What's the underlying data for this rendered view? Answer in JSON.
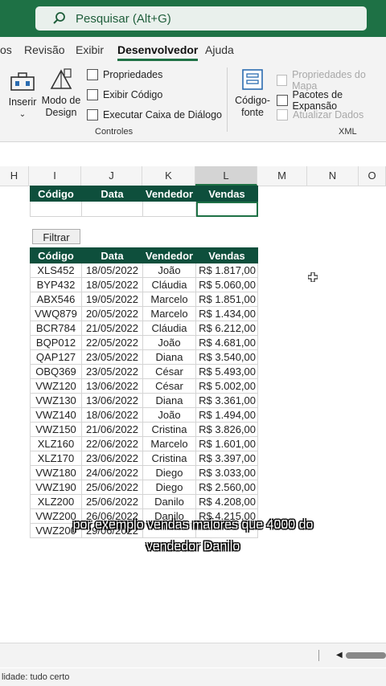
{
  "search": {
    "placeholder": "Pesquisar (Alt+G)"
  },
  "tabs": [
    "os",
    "Revisão",
    "Exibir",
    "Desenvolvedor",
    "Ajuda"
  ],
  "active_tab": "Desenvolvedor",
  "ribbon": {
    "inserir": "Inserir",
    "modo_design_1": "Modo de",
    "modo_design_2": "Design",
    "propriedades": "Propriedades",
    "exibir_codigo": "Exibir Código",
    "executar_caixa": "Executar Caixa de Diálogo",
    "controles_label": "Controles",
    "codigo_fonte_1": "Código-",
    "codigo_fonte_2": "fonte",
    "propriedades_mapa": "Propriedades do Mapa",
    "pacotes_expansao": "Pacotes de Expansão",
    "atualizar_dados": "Atualizar Dados",
    "xml_label": "XML"
  },
  "columns": [
    "H",
    "I",
    "J",
    "K",
    "L",
    "M",
    "N",
    "O"
  ],
  "selected_column": "L",
  "criteria_table": {
    "headers": [
      "Código",
      "Data",
      "Vendedor",
      "Vendas"
    ]
  },
  "filter_button": "Filtrar",
  "data_table": {
    "headers": [
      "Código",
      "Data",
      "Vendedor",
      "Vendas"
    ],
    "rows": [
      [
        "XLS452",
        "18/05/2022",
        "João",
        "R$ 1.817,00"
      ],
      [
        "BYP432",
        "18/05/2022",
        "Cláudia",
        "R$ 5.060,00"
      ],
      [
        "ABX546",
        "19/05/2022",
        "Marcelo",
        "R$ 1.851,00"
      ],
      [
        "VWQ879",
        "20/05/2022",
        "Marcelo",
        "R$ 1.434,00"
      ],
      [
        "BCR784",
        "21/05/2022",
        "Cláudia",
        "R$ 6.212,00"
      ],
      [
        "BQP012",
        "22/05/2022",
        "João",
        "R$ 4.681,00"
      ],
      [
        "QAP127",
        "23/05/2022",
        "Diana",
        "R$ 3.540,00"
      ],
      [
        "OBQ369",
        "23/05/2022",
        "César",
        "R$ 5.493,00"
      ],
      [
        "VWZ120",
        "13/06/2022",
        "César",
        "R$ 5.002,00"
      ],
      [
        "VWZ130",
        "13/06/2022",
        "Diana",
        "R$ 3.361,00"
      ],
      [
        "VWZ140",
        "18/06/2022",
        "João",
        "R$ 1.494,00"
      ],
      [
        "VWZ150",
        "21/06/2022",
        "Cristina",
        "R$ 3.826,00"
      ],
      [
        "XLZ160",
        "22/06/2022",
        "Marcelo",
        "R$ 1.601,00"
      ],
      [
        "XLZ170",
        "23/06/2022",
        "Cristina",
        "R$ 3.397,00"
      ],
      [
        "VWZ180",
        "24/06/2022",
        "Diego",
        "R$ 3.033,00"
      ],
      [
        "VWZ190",
        "25/06/2022",
        "Diego",
        "R$ 2.560,00"
      ],
      [
        "XLZ200",
        "25/06/2022",
        "Danilo",
        "R$ 4.208,00"
      ],
      [
        "VWZ200",
        "26/06/2022",
        "Danilo",
        "R$ 4.215,00"
      ],
      [
        "VWZ200",
        "29/06/2022",
        "",
        ""
      ]
    ]
  },
  "caption": {
    "line1": "por exemplo vendas maiores que 4000 do",
    "line2": "vendedor Danilo"
  },
  "status": "lidade: tudo certo"
}
